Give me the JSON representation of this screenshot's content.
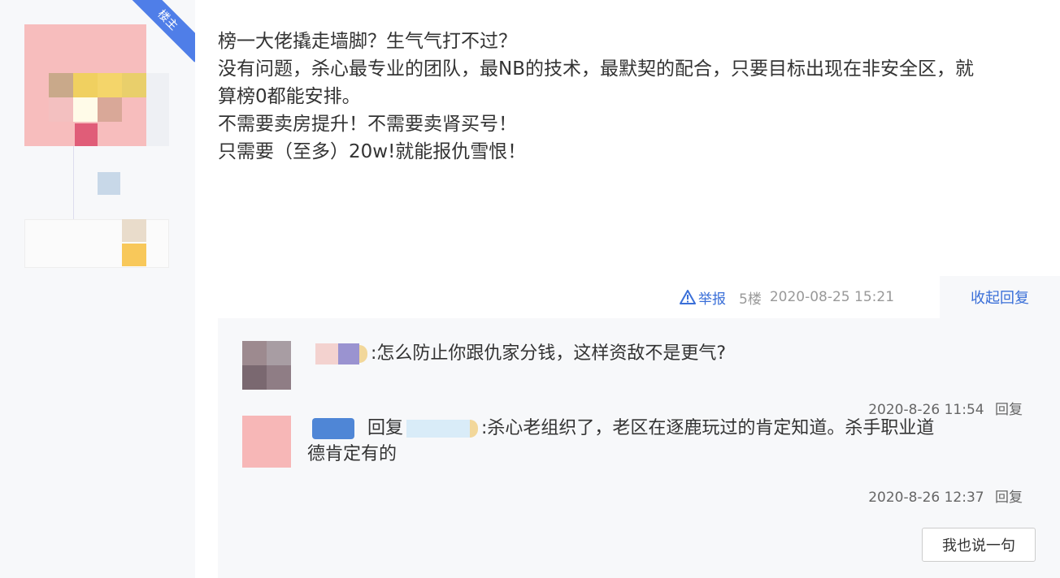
{
  "badge": "楼主",
  "post": {
    "lines": [
      "榜一大佬撬走墙脚？生气气打不过？",
      "没有问题，杀心最专业的团队，最NB的技术，最默契的配合，只要目标出现在非安全区，就",
      "算榜0都能安排。",
      "不需要卖房提升！不需要卖肾买号！",
      "只需要（至多）20w!就能报仇雪恨！"
    ],
    "report": "举报",
    "floor": "5楼",
    "time": "2020-08-25 15:21",
    "collapse": "收起回复"
  },
  "replies": [
    {
      "text": ":怎么防止你跟仇家分钱，这样资敌不是更气?",
      "time": "2020-8-26 11:54",
      "reply_btn": "回复"
    },
    {
      "prefix": "回复",
      "text_line1": ":杀心老组织了，老区在逐鹿玩过的肯定知道。杀手职业道",
      "text_line2": "德肯定有的",
      "time": "2020-8-26 12:37",
      "reply_btn": "回复"
    }
  ],
  "say_button": "我也说一句",
  "colors": {
    "link": "#3a6fd8",
    "badge": "#4f7ee8"
  }
}
